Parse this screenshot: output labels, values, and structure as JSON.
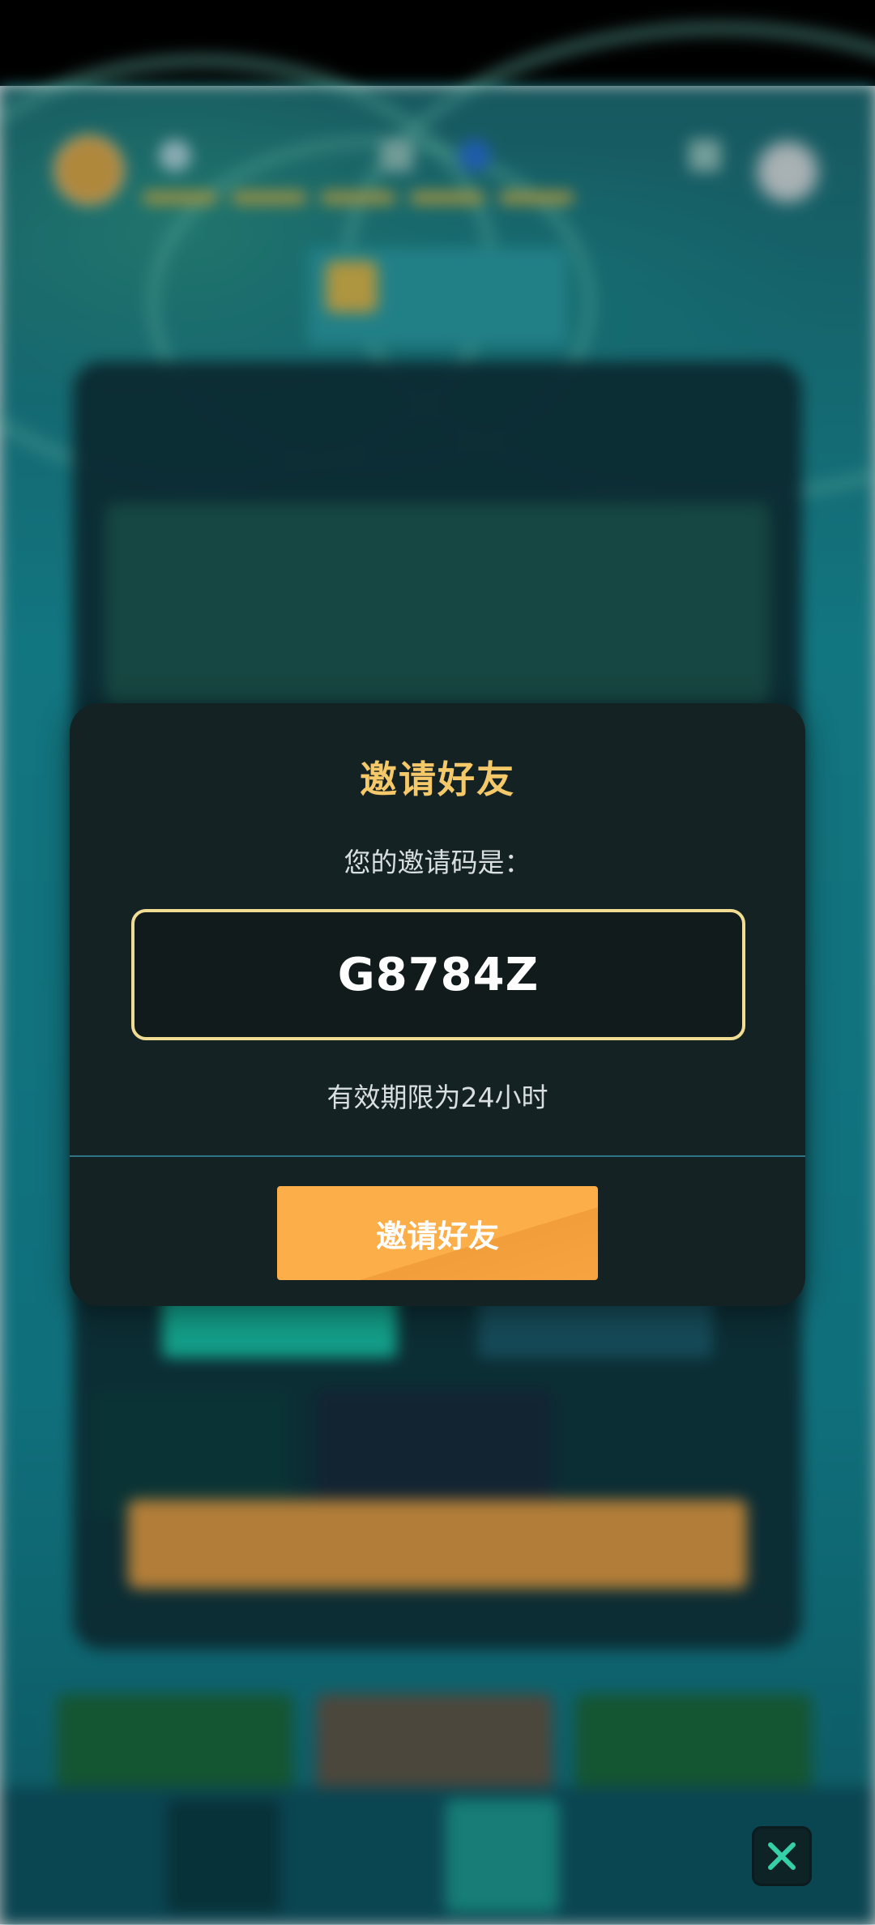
{
  "modal": {
    "title": "邀请好友",
    "subtitle": "您的邀请码是：",
    "invite_code": "G8784Z",
    "validity": "有效期限为24小时",
    "invite_button_label": "邀请好友"
  },
  "colors": {
    "modal_background": "#142224",
    "title_gold": "#f5c86a",
    "code_border": "#f1dc93",
    "button_orange": "#fcae49",
    "divider_teal": "#2e7485",
    "close_icon_green": "#35d0a8"
  },
  "icons": {
    "close": "close-icon"
  }
}
